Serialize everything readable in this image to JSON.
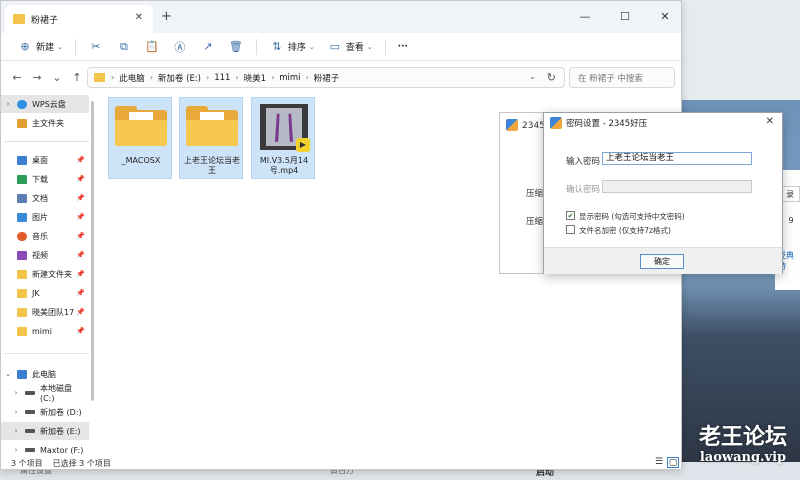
{
  "explorer": {
    "tab_title": "粉裙子",
    "toolbar": {
      "new_label": "新建",
      "sort_label": "排序",
      "view_label": "查看",
      "more_label": "···"
    },
    "breadcrumb": [
      "此电脑",
      "新加卷 (E:)",
      "111",
      "晓美1",
      "mimi",
      "粉裙子"
    ],
    "search_placeholder": "在 粉裙子 中搜索",
    "sidebar": {
      "top": [
        {
          "label": "WPS云盘",
          "icon": "cloud-icon",
          "color": "#2f8fe0"
        },
        {
          "label": "主文件夹",
          "icon": "home-icon",
          "color": "#e0a030"
        }
      ],
      "pinned": [
        {
          "label": "桌面",
          "icon": "desktop-icon",
          "color": "#3a7fd0"
        },
        {
          "label": "下载",
          "icon": "download-icon",
          "color": "#2f9d5a"
        },
        {
          "label": "文档",
          "icon": "document-icon",
          "color": "#5a7fb0"
        },
        {
          "label": "图片",
          "icon": "pictures-icon",
          "color": "#3a8ad8"
        },
        {
          "label": "音乐",
          "icon": "music-icon",
          "color": "#e05a2a"
        },
        {
          "label": "视频",
          "icon": "video-icon",
          "color": "#8a4ab8"
        },
        {
          "label": "新建文件夹",
          "icon": "folder-icon",
          "color": "#f3c44a"
        },
        {
          "label": "JK",
          "icon": "folder-icon",
          "color": "#f3c44a"
        },
        {
          "label": "晓美团队17",
          "icon": "folder-icon",
          "color": "#f3c44a"
        },
        {
          "label": "mimi",
          "icon": "folder-icon",
          "color": "#f3c44a"
        }
      ],
      "drives": [
        {
          "label": "此电脑",
          "icon": "computer-icon",
          "color": "#3a7fd0"
        },
        {
          "label": "本地磁盘 (C:)",
          "icon": "drive-icon",
          "color": "#555555"
        },
        {
          "label": "新加卷 (D:)",
          "icon": "drive-icon",
          "color": "#555555"
        },
        {
          "label": "新加卷 (E:)",
          "icon": "drive-icon",
          "color": "#555555"
        },
        {
          "label": "Maxtor (F:)",
          "icon": "drive-icon",
          "color": "#555555"
        }
      ]
    },
    "files": [
      {
        "name": "_MACOSX",
        "type": "folder"
      },
      {
        "name": "上老王论坛当老王",
        "type": "folder"
      },
      {
        "name": "MI.V3.5月14号.mp4",
        "type": "video"
      }
    ],
    "status": {
      "count": "3 个项目",
      "selected": "已选择 3 个项目"
    }
  },
  "zip_dialog": {
    "title": "2345好",
    "label1": "压缩",
    "label2": "压缩"
  },
  "password_dialog": {
    "title": "密码设置 - 2345好压",
    "enter_label": "输入密码",
    "enter_value": "上老王论坛当老王",
    "confirm_label": "确认密码",
    "confirm_value": "",
    "show_password_label": "显示密码 (勾选可支持中文密码)",
    "show_password_checked": true,
    "encrypt_names_label": "文件名加密 (仅支持7z格式)",
    "encrypt_names_checked": false,
    "ok_label": "确定"
  },
  "background": {
    "right_btn1": "录",
    "right_btn2": "9",
    "right_link": "经典特",
    "bottom_left": "属性设置",
    "bottom_mid": "黄百万",
    "bottom_right": "启动"
  },
  "watermark": {
    "line1": "老王论坛",
    "line2": "laowang.vip"
  },
  "colors": {
    "accent": "#3a7fd0",
    "selection": "#cde3f7",
    "folder": "#f6c84f"
  }
}
